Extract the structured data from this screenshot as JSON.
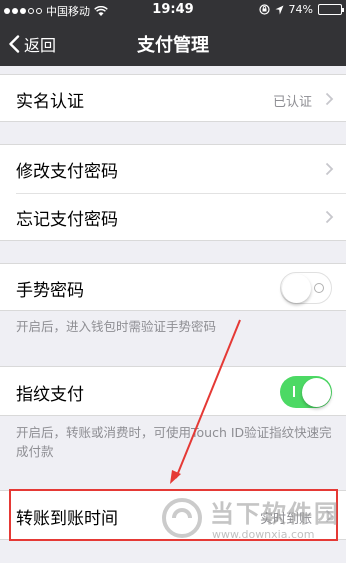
{
  "status_bar": {
    "carrier": "中国移动",
    "time": "19:49",
    "battery": "74%",
    "signal_dots_filled": 3,
    "icons": [
      "signal-dots-icon",
      "wifi-icon",
      "lock-rotation-icon",
      "location-arrow-icon",
      "battery-icon"
    ]
  },
  "nav": {
    "back_label": "返回",
    "title": "支付管理"
  },
  "settings": {
    "real_name": {
      "label": "实名认证",
      "value": "已认证"
    },
    "change_password": {
      "label": "修改支付密码"
    },
    "forgot_password": {
      "label": "忘记支付密码"
    },
    "gesture_password": {
      "label": "手势密码",
      "enabled": false,
      "note": "开启后，进入钱包时需验证手势密码"
    },
    "fingerprint": {
      "label": "指纹支付",
      "enabled": true,
      "note": "开启后，转账或消费时，可使用Touch ID验证指纹快速完成付款"
    },
    "transfer_time": {
      "label": "转账到账时间",
      "value": "实时到账"
    }
  },
  "colors": {
    "nav_background": "#333336",
    "toggle_on": "#4cd964",
    "page_background": "#efeff4",
    "annotation": "#e53935"
  },
  "watermark": {
    "text": "当下软件园",
    "url": "www.downxia.com"
  }
}
